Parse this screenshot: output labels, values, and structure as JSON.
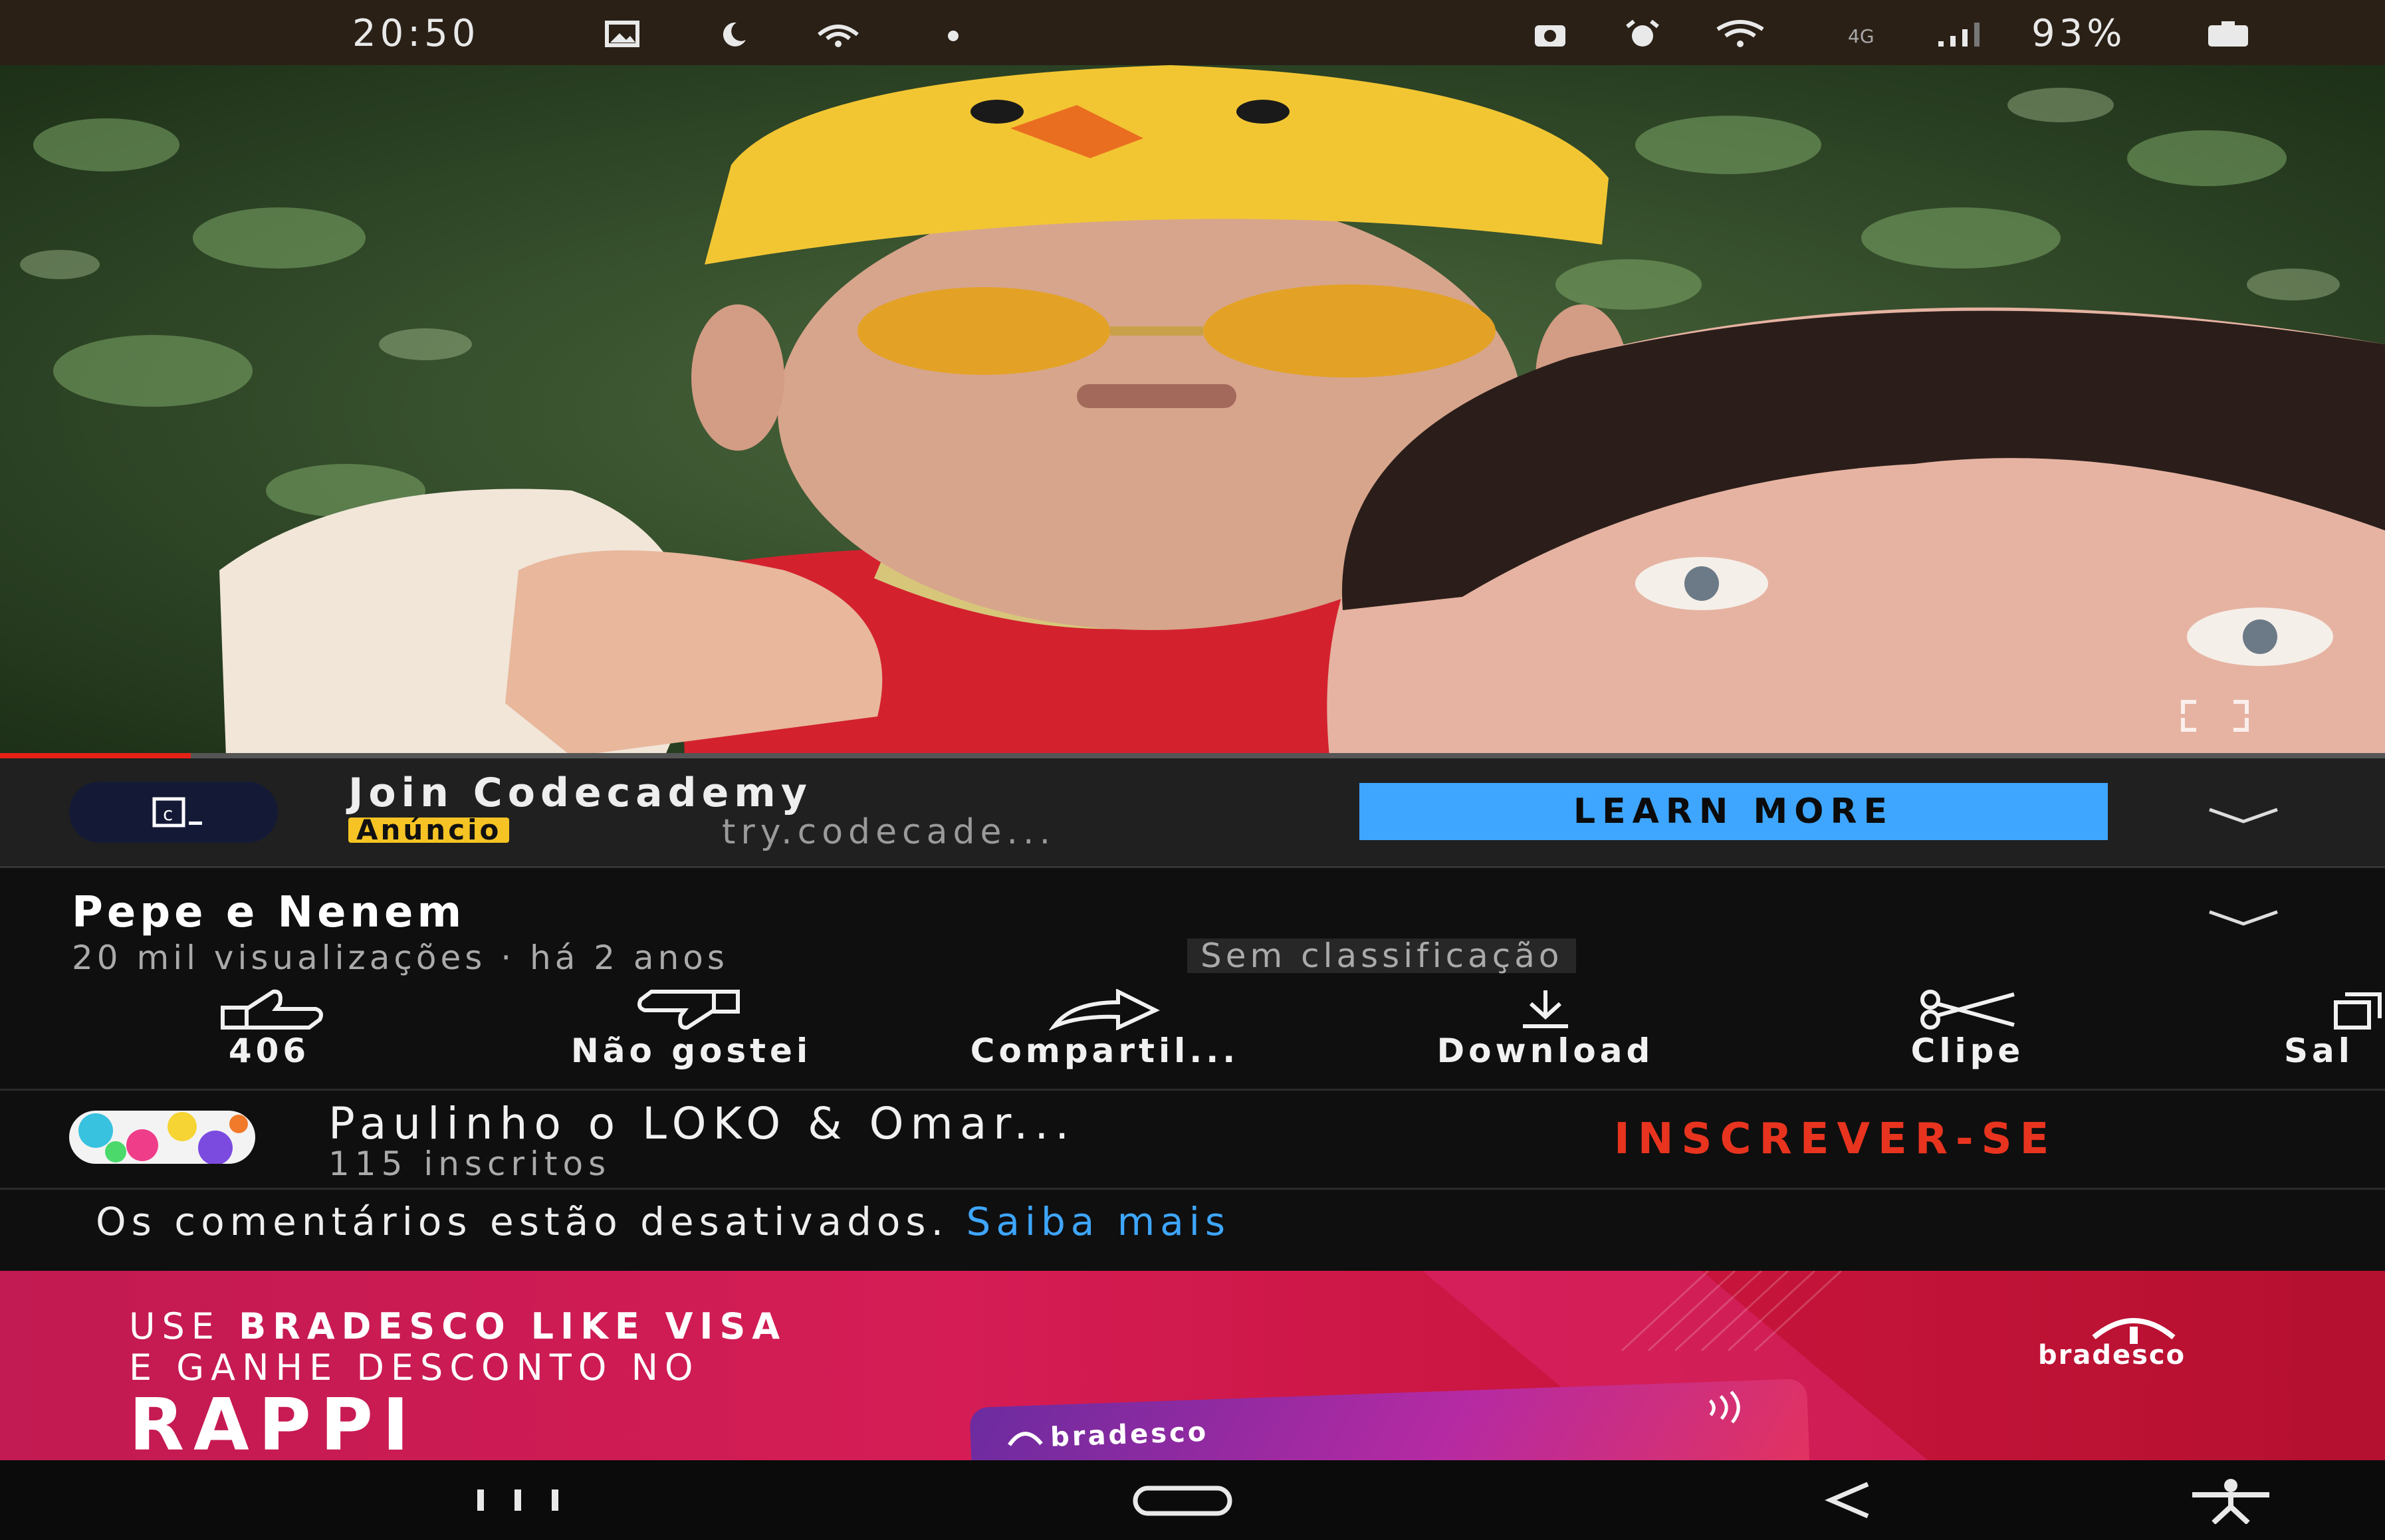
{
  "status_bar": {
    "time": "20:50",
    "network": "4G",
    "battery": "93%",
    "icons": [
      "image-icon",
      "moon-icon",
      "hotspot-icon",
      "dot-icon",
      "camera-icon",
      "alarm-icon",
      "wifi-icon",
      "signal-icon",
      "battery-icon"
    ]
  },
  "video": {
    "progress": 0.08,
    "progress_color": "#e62117"
  },
  "ad": {
    "title": "Join Codecademy",
    "badge": "Anúncio",
    "url": "try.codecade...",
    "cta": "LEARN MORE",
    "accent": "#3ea6ff"
  },
  "video_info": {
    "title": "Pepe e Nenem",
    "meta": "20 mil visualizações · há 2 anos",
    "rating": "Sem classificação"
  },
  "actions": [
    {
      "icon": "thumbs-up-icon",
      "label": "406"
    },
    {
      "icon": "thumbs-down-icon",
      "label": "Não gostei"
    },
    {
      "icon": "share-icon",
      "label": "Compartil..."
    },
    {
      "icon": "download-icon",
      "label": "Download"
    },
    {
      "icon": "scissors-icon",
      "label": "Clipe"
    },
    {
      "icon": "save-icon",
      "label": "Sal"
    }
  ],
  "channel": {
    "name": "Paulinho o LOKO & Omar...",
    "subscribers": "115 inscritos",
    "subscribe_label": "INSCREVER-SE",
    "subscribe_color": "#e8341f"
  },
  "comments": {
    "text": "Os comentários estão desativados.",
    "link": "Saiba mais"
  },
  "banner": {
    "line1_prefix": "USE",
    "line1_bold": "BRADESCO LIKE VISA",
    "line2": "E GANHE DESCONTO NO",
    "line3": "RAPPI",
    "brand": "bradesco",
    "card_brand": "bradesco"
  }
}
